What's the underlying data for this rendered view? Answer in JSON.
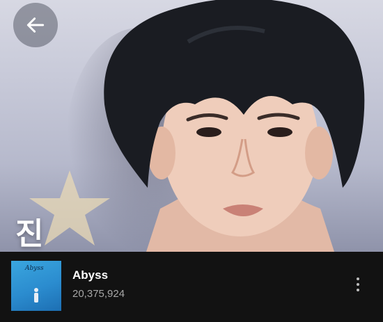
{
  "artist": {
    "name": "진"
  },
  "track": {
    "title": "Abyss",
    "play_count": "20,375,924",
    "cover_text": "Abyss"
  },
  "icons": {
    "back": "arrow-left-icon",
    "more": "more-vertical-icon"
  },
  "colors": {
    "background": "#121212",
    "text_primary": "#ffffff",
    "text_secondary": "#a7a7a7",
    "cover_blue": "#2b8ccf"
  }
}
